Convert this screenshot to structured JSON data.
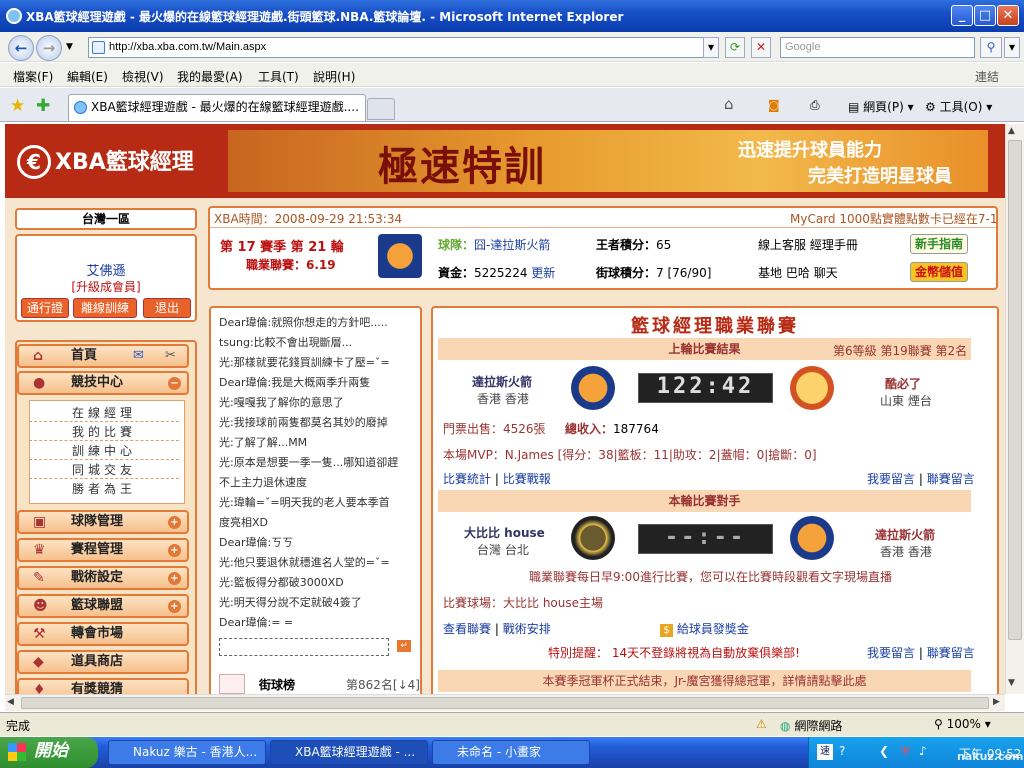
{
  "window": {
    "title": "XBA籃球經理遊戲 - 最火爆的在線籃球經理遊戲.街頭籃球.NBA.籃球論壇. - Microsoft Internet Explorer"
  },
  "address": {
    "url": "http://xba.xba.com.tw/Main.aspx",
    "search_placeholder": "Google"
  },
  "menu": [
    "檔案(F)",
    "編輯(E)",
    "檢視(V)",
    "我的最愛(A)",
    "工具(T)",
    "說明(H)"
  ],
  "menu_links": "連結",
  "tab": {
    "title": "XBA籃球經理遊戲 - 最火爆的在線籃球經理遊戲...."
  },
  "toolbar": {
    "page": "網頁(P)",
    "tools": "工具(O)"
  },
  "header": {
    "logo": "XBA籃球經理",
    "banner_title": "極速特訓",
    "banner_line1": "迅速提升球員能力",
    "banner_line2": "完美打造明星球員"
  },
  "user": {
    "region": "台灣一區",
    "name": "艾佛遜",
    "upgrade": "[升級成會員]",
    "btn_pass": "通行證",
    "btn_leave": "離線訓練",
    "btn_exit": "退出"
  },
  "nav": {
    "home": "首頁",
    "arena": "競技中心",
    "subs": [
      "在線經理",
      "我的比賽",
      "訓練中心",
      "同城交友",
      "勝者為王"
    ],
    "team": "球隊管理",
    "schedule": "賽程管理",
    "tactics": "戰術設定",
    "league": "籃球聯盟",
    "transfer": "轉會市場",
    "shop": "道具商店",
    "more": "有獎競猜"
  },
  "info": {
    "time_label": "XBA時間：2008-09-29 21:53:34",
    "ticker": "MyCard 1000點實體點數卡已經在7-1",
    "season": "第 17 賽季 第 21 輪",
    "league": "職業聯賽：6.19",
    "team_label": "球隊：",
    "team_value": "囧-達拉斯火箭",
    "king_label": "王者積分：",
    "king_value": "65",
    "cash_label": "資金：",
    "cash_value": "5225224",
    "update": "更新",
    "score_label": "街球積分：",
    "score_value": "7 [76/90]",
    "service": "線上客服",
    "manual": "經理手冊",
    "base": "基地",
    "bar": "巴哈",
    "chat": "聊天",
    "guide_btn": "新手指南",
    "gold_btn": "金幣儲值"
  },
  "chat": [
    "Dear瑋倫:就照你想走的方針吧.....",
    "tsung:比較不會出現斷層...",
    "光:那樣就要花錢買訓練卡了壓=ˇ=",
    "Dear瑋倫:我是大概兩季升兩隻",
    "光:嘎嘎我了解你的意思了",
    "光:我接球前兩隻都莫名其妙的廢掉",
    "光:了解了解...MM",
    "光:原本是想要一季一隻...哪知道卻趕",
    "不上主力退休速度",
    "光:瑋輪=ˇ=明天我的老人要本季首",
    "度亮相XD",
    "Dear瑋倫:ㄎㄎ",
    "光:他只要退休就穩進名人堂的=ˇ=",
    "光:籃板得分都破3000XD",
    "光:明天得分說不定就破4簽了",
    "Dear瑋倫:= ="
  ],
  "rank": {
    "label": "街球榜",
    "value": "第862名[↓4]"
  },
  "league_panel": {
    "title": "籃球經理職業聯賽",
    "last_label": "上輪比賽結果",
    "last_meta": "第6等級 第19聯賽 第2名",
    "home_team": "達拉斯火箭",
    "home_city": "香港 香港",
    "score": "122:42",
    "away_team": "酷必了",
    "away_city": "山東 煙台",
    "tickets": "門票出售：4526張",
    "income_label": "總收入：",
    "income_value": "187764",
    "mvp": "本場MVP：N.James [得分：38|籃板：11|助攻：2|蓋帽：0|搶斷：0]",
    "stats": "比賽統計",
    "report": "比賽戰報",
    "msg1": "我要留言",
    "msg2": "聯賽留言",
    "next_label": "本輪比賽對手",
    "next_home": "大比比 house",
    "next_home_city": "台灣 台北",
    "next_score": "--:--",
    "next_away": "達拉斯火箭",
    "next_away_city": "香港 香港",
    "notice": "職業聯賽每日早9:00進行比賽，您可以在比賽時段觀看文字現場直播",
    "venue": "比賽球場：大比比 house主場",
    "view": "查看聯賽",
    "tactics": "戰術安排",
    "award": "給球員發獎金",
    "remind": "特別提醒： 14天不登錄將視為自動放棄俱樂部!",
    "msg3": "我要留言",
    "msg4": "聯賽留言",
    "footer": "本賽季冠軍杯正式結束，Jr-魔宮獲得總冠軍，詳情請點擊此處"
  },
  "status": {
    "left": "完成",
    "zone": "網際網路",
    "zoom": "100%"
  },
  "taskbar": {
    "start": "開始",
    "t1": "Nakuz 樂古 - 香港人...",
    "t2": "XBA籃球經理遊戲 - ...",
    "t3": "未命名 - 小畫家",
    "clock": "下午 09:52",
    "wm": "nakuz.com"
  }
}
